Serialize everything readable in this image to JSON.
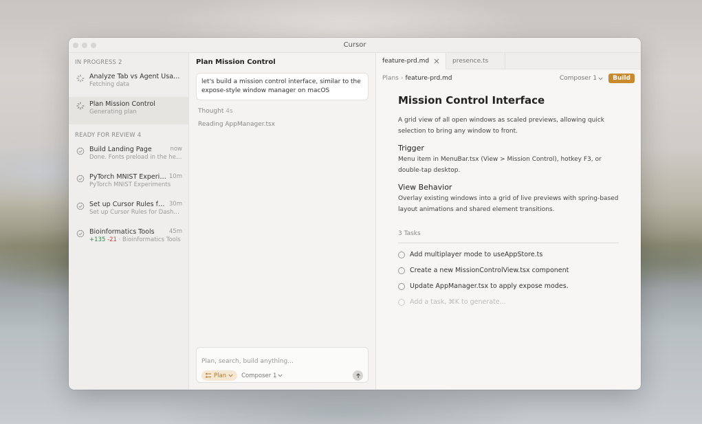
{
  "window": {
    "title": "Cursor"
  },
  "sidebar": {
    "in_progress_header": "IN PROGRESS 2",
    "in_progress": [
      {
        "title": "Analyze Tab vs Agent Usage P...",
        "subtitle": "Fetching data",
        "icon": "spinner-icon"
      },
      {
        "title": "Plan Mission Control",
        "subtitle": "Generating plan",
        "icon": "spinner-icon"
      }
    ],
    "review_header": "READY FOR REVIEW 4",
    "review": [
      {
        "title": "Build Landing Page",
        "time": "now",
        "subtitle": "Done. Fonts preload in the head,..."
      },
      {
        "title": "PyTorch MNIST Experim...",
        "time": "10m",
        "subtitle": "PyTorch MNIST Experiments"
      },
      {
        "title": "Set up Cursor Rules for ...",
        "time": "30m",
        "subtitle": "Set up Cursor Rules for Dashboa..."
      },
      {
        "title": "Bioinformatics Tools",
        "time": "45m",
        "added": "+135",
        "removed": "-21",
        "subtitle": "· Bioinformatics Tools"
      }
    ]
  },
  "chat": {
    "title": "Plan Mission Control",
    "user_message": "let's build a mission control interface, similar to the expose-style window manager on macOS",
    "thought_label": "Thought",
    "thought_time": "4s",
    "reading": "Reading AppManager.tsx",
    "composer": {
      "placeholder": "Plan, search, build anything...",
      "mode": "Plan",
      "model": "Composer 1"
    }
  },
  "doc": {
    "tabs": [
      {
        "label": "feature-prd.md",
        "active": true
      },
      {
        "label": "presence.ts",
        "active": false
      }
    ],
    "breadcrumb_root": "Plans",
    "breadcrumb_current": "feature-prd.md",
    "composer_label": "Composer 1",
    "build_label": "Build",
    "h1": "Mission Control Interface",
    "intro": "A grid view of all open windows as scaled previews, allowing quick selection to bring any window to front.",
    "trigger_h": "Trigger",
    "trigger_p": "Menu item in MenuBar.tsx (View > Mission Control), hotkey F3, or double-tap desktop.",
    "view_h": "View Behavior",
    "view_p": "Overlay existing windows into a grid of live previews with spring-based layout animations and shared element transitions.",
    "tasks_header": "3 Tasks",
    "tasks": [
      "Add multiplayer mode to useAppStore.ts",
      "Create a new MissionControlView.tsx component",
      "Update AppManager.tsx to apply expose modes."
    ],
    "task_placeholder": "Add a task, ⌘K to generate..."
  },
  "colors": {
    "accent": "#c98a2f",
    "plan_chip_bg": "#f6e7d2",
    "added": "#2e8b4a",
    "removed": "#c9423b"
  }
}
